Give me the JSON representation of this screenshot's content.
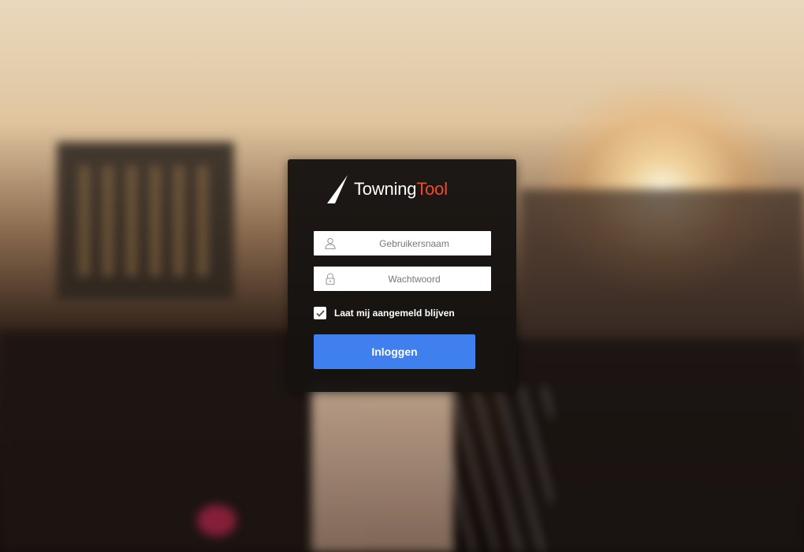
{
  "brand": {
    "name_part1": "Towning",
    "name_part2": "Tool",
    "accent_color": "#ef4b2f",
    "logo_icon": "slash-mark-icon"
  },
  "login": {
    "username_placeholder": "Gebruikersnaam",
    "username_icon": "user-icon",
    "password_placeholder": "Wachtwoord",
    "password_icon": "lock-icon",
    "remember_label": "Laat mij aangemeld blijven",
    "remember_checked": true,
    "submit_label": "Inloggen",
    "submit_color": "#3f80ee"
  },
  "background": {
    "description_icon": "city-sunset-background"
  }
}
